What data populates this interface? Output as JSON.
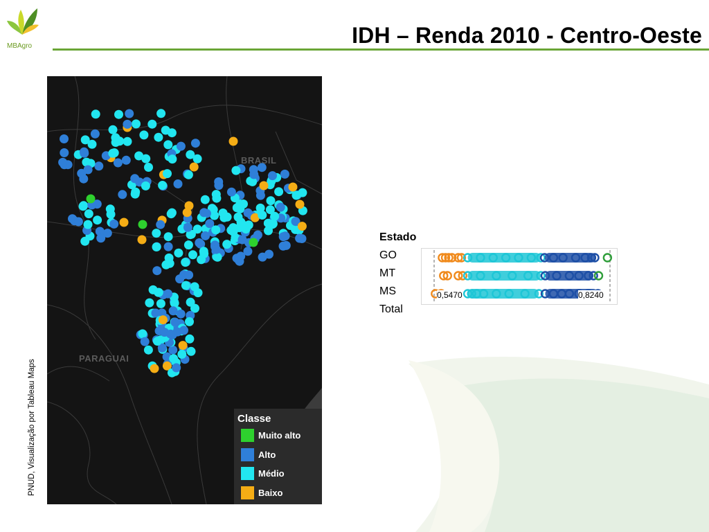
{
  "header": {
    "title": "IDH – Renda  2010 - Centro-Oeste",
    "logo_text": "MBAgro",
    "accent_color": "#6aa536"
  },
  "map": {
    "labels": [
      "BRASIL",
      "PARAGUAI"
    ],
    "legend": {
      "title": "Classe",
      "items": [
        {
          "label": "Muito alto",
          "color": "#2ed12e"
        },
        {
          "label": "Alto",
          "color": "#2f7fd8"
        },
        {
          "label": "Médio",
          "color": "#22e6f0"
        },
        {
          "label": "Baixo",
          "color": "#f5ad15"
        }
      ]
    }
  },
  "source_text": "PNUD, Visualização por Tableau Maps",
  "chart_data": {
    "type": "scatter",
    "title": "",
    "header": "Estado",
    "categories": [
      "GO",
      "MT",
      "MS",
      "Total"
    ],
    "axis_labels": [
      "0,5470",
      "0,8240"
    ],
    "xlim": [
      0.547,
      0.824
    ],
    "series": [
      {
        "category": "GO",
        "classes": {
          "Baixo": [
            0.56,
            0.565,
            0.57,
            0.575,
            0.585,
            0.59
          ],
          "Médio": [
            0.6,
            0.62,
            0.64,
            0.66,
            0.68,
            0.7,
            0.715
          ],
          "Alto": [
            0.721,
            0.735,
            0.75,
            0.77,
            0.785,
            0.795,
            0.8
          ],
          "Muito alto": [
            0.82
          ]
        }
      },
      {
        "category": "MT",
        "classes": {
          "Baixo": [
            0.562,
            0.568,
            0.585,
            0.592
          ],
          "Médio": [
            0.6,
            0.62,
            0.645,
            0.67,
            0.695,
            0.715
          ],
          "Alto": [
            0.722,
            0.74,
            0.76,
            0.775,
            0.79,
            0.798
          ],
          "Muito alto": [
            0.806
          ]
        }
      },
      {
        "category": "MS",
        "classes": {
          "Baixo": [
            0.549,
            0.558
          ],
          "Médio": [
            0.6,
            0.606,
            0.614,
            0.625,
            0.645,
            0.665,
            0.69,
            0.712
          ],
          "Alto": [
            0.722,
            0.735,
            0.748,
            0.76,
            0.775,
            0.79,
            0.805
          ]
        }
      }
    ]
  }
}
